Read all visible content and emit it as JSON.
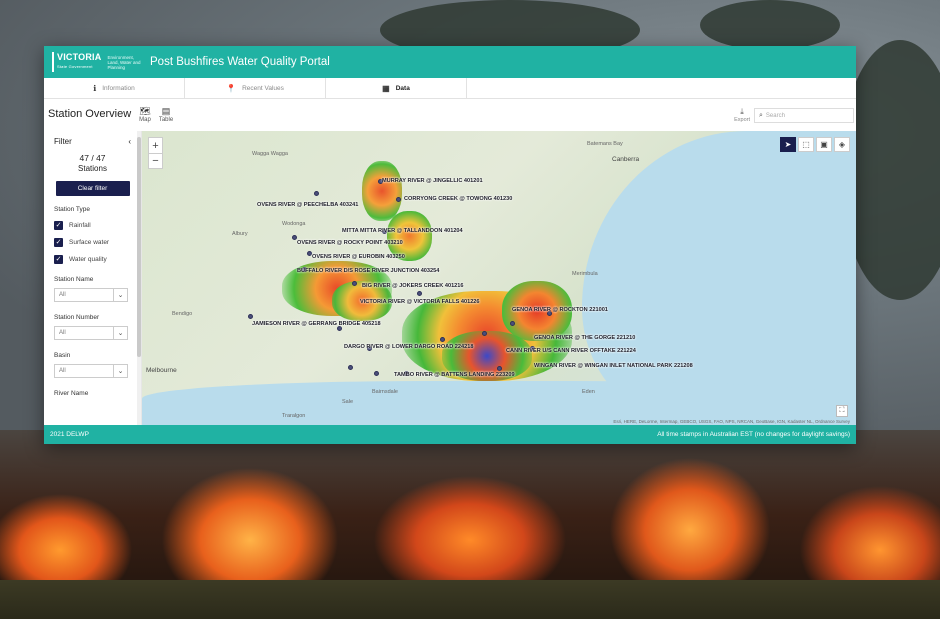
{
  "header": {
    "logo_name": "VICTORIA",
    "logo_sub": "State Government",
    "logo_dept": "Environment, Land, Water and Planning",
    "title": "Post Bushfires Water Quality Portal"
  },
  "tabs": [
    {
      "label": "Information",
      "icon": "info-icon"
    },
    {
      "label": "Recent Values",
      "icon": "pin-icon"
    },
    {
      "label": "Data",
      "icon": "grid-icon"
    }
  ],
  "toolbar": {
    "page_title": "Station Overview",
    "map_label": "Map",
    "table_label": "Table",
    "export_label": "Export",
    "search_placeholder": "Search"
  },
  "filter": {
    "title": "Filter",
    "shown": "47",
    "separator": "/",
    "total": "47",
    "stations_label": "Stations",
    "clear_label": "Clear filter",
    "station_type_label": "Station Type",
    "station_types": [
      "Rainfall",
      "Surface water",
      "Water quality"
    ],
    "station_name_label": "Station Name",
    "station_name_value": "All",
    "station_number_label": "Station Number",
    "station_number_value": "All",
    "basin_label": "Basin",
    "basin_value": "All",
    "river_name_label": "River Name"
  },
  "map": {
    "stations": [
      "MURRAY RIVER @ JINGELLIC 401201",
      "CORRYONG CREEK @ TOWONG 401230",
      "OVENS RIVER @ PEECHELBA 403241",
      "MITTA MITTA RIVER @ TALLANDOON 401204",
      "OVENS RIVER @ ROCKY POINT 403210",
      "OVENS RIVER @ EUROBIN 403250",
      "BUFFALO RIVER D/S ROSE RIVER JUNCTION 403254",
      "BIG RIVER @ JOKERS CREEK 401216",
      "VICTORIA RIVER @ VICTORIA FALLS 401226",
      "GENOA RIVER @ ROCKTON 221001",
      "JAMIESON RIVER @ GERRANG BRIDGE 405218",
      "GENOA RIVER @ THE GORGE 221210",
      "DARGO RIVER @ LOWER DARGO ROAD 224218",
      "CANN RIVER U/S CANN RIVER OFFTAKE 221224",
      "WINGAN RIVER @ WINGAN INLET NATIONAL PARK 221208",
      "TAMBO RIVER @ BATTENS LANDING 223209"
    ],
    "places": [
      "Canberra",
      "Batemans Bay",
      "Albury",
      "Wagga Wagga",
      "Melbourne",
      "Wodonga",
      "Bendigo",
      "Traralgon",
      "Eden",
      "Bairnsdale",
      "Sale",
      "Merimbula"
    ],
    "attribution": "Esri, HERE, DeLorme, Intermap, GEBCO, USGS, FAO, NPS, NRCAN, GeoBase, IGN, Kadaster NL, Ordnance Survey"
  },
  "footer": {
    "left": "2021 DELWP",
    "right": "All time stamps in Australian EST (no changes for daylight savings)"
  },
  "colors": {
    "brand": "#20b2a3",
    "navy": "#1a1f4e"
  }
}
